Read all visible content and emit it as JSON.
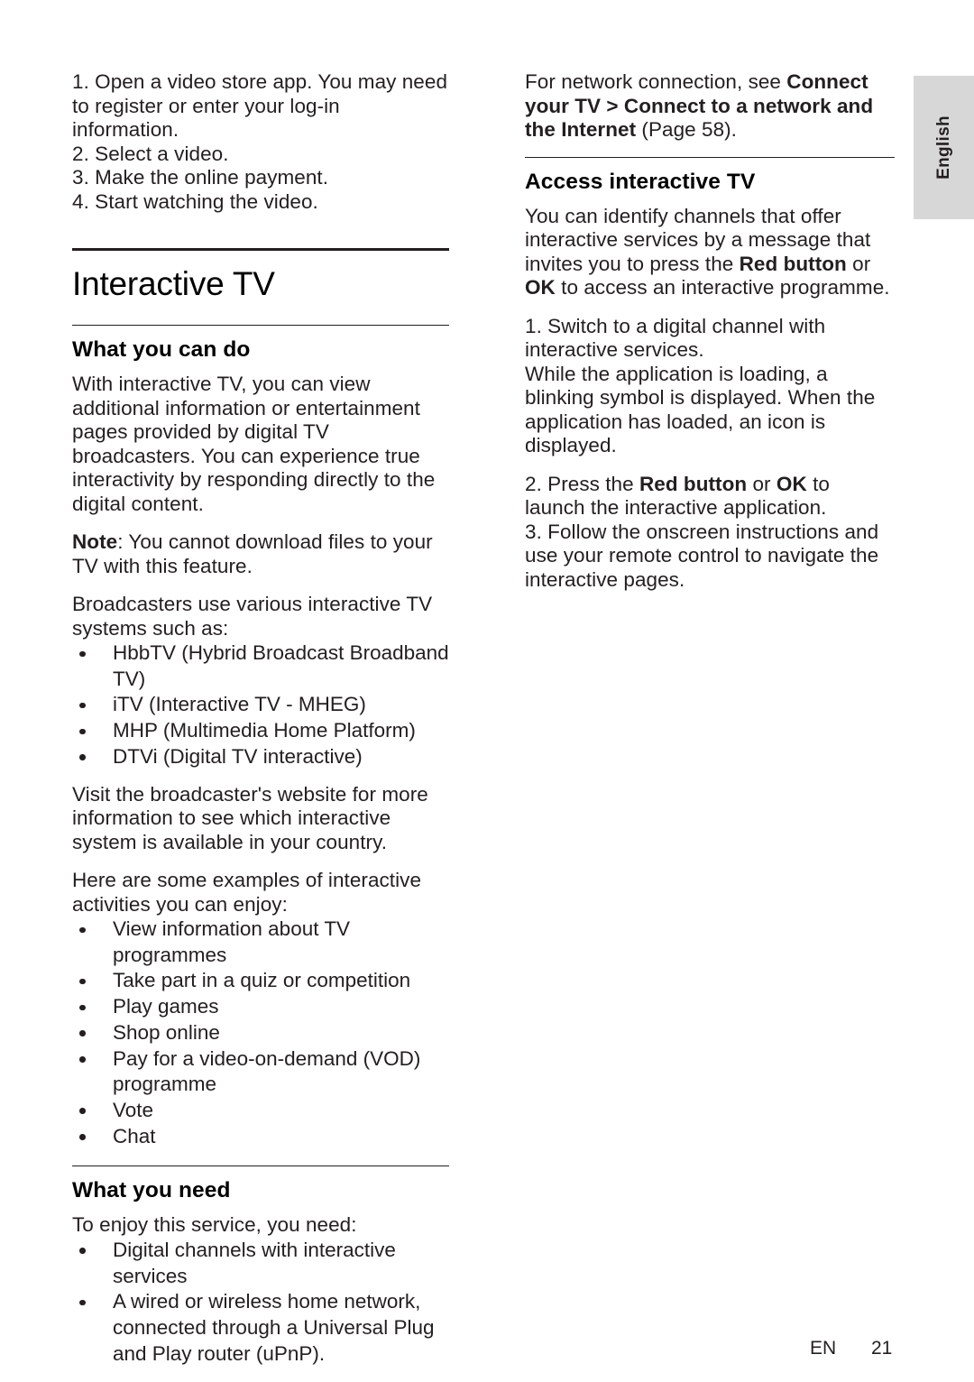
{
  "language_tab": {
    "label": "English"
  },
  "left_column": {
    "intro_steps": [
      "1. Open a video store app. You may need to register or enter your log-in information.",
      "2. Select a video.",
      "3. Make the online payment.",
      "4. Start watching the video."
    ],
    "chapter_title": "Interactive TV",
    "section_what_you_can_do": {
      "heading": "What you can do",
      "para1": "With interactive TV, you can view additional information or entertainment pages provided by digital TV broadcasters. You can experience true interactivity by responding directly to the digital content.",
      "note_label": "Note",
      "note_text": ": You cannot download files to your TV with this feature.",
      "para2": "Broadcasters use various interactive TV systems such as:",
      "systems": [
        "HbbTV (Hybrid Broadcast Broadband TV)",
        "iTV (Interactive TV - MHEG)",
        "MHP (Multimedia Home Platform)",
        "DTVi (Digital TV interactive)"
      ],
      "para3": "Visit the broadcaster's website for more information to see which interactive system is available in your country.",
      "para4": "Here are some examples of interactive activities you can enjoy:",
      "activities": [
        "View information about TV programmes",
        "Take part in a quiz or competition",
        "Play games",
        "Shop online",
        "Pay for a video-on-demand (VOD) programme",
        "Vote",
        "Chat"
      ]
    },
    "section_what_you_need": {
      "heading": "What you need",
      "intro": "To enjoy this service, you need:",
      "requirements": [
        "Digital channels with interactive services",
        "A wired or wireless home network, connected through a Universal Plug and Play router (uPnP)."
      ]
    }
  },
  "right_column": {
    "network_note": {
      "prefix": "For network connection, see ",
      "bold_ref": "Connect your TV > Connect to a network and the Internet",
      "suffix": " (Page 58)."
    },
    "section_access": {
      "heading": "Access interactive TV",
      "para1_a": "You can identify channels that offer interactive services by a message that invites you to press the ",
      "para1_bold1": "Red button",
      "para1_b": " or ",
      "para1_bold2": "OK",
      "para1_c": " to access an interactive programme.",
      "step1": "1. Switch to a digital channel with interactive services.",
      "step1_note": "While the application is loading, a blinking symbol is displayed. When the application has loaded, an icon is displayed.",
      "step2_a": "2. Press the ",
      "step2_bold1": "Red button",
      "step2_b": " or ",
      "step2_bold2": "OK",
      "step2_c": " to launch the interactive application.",
      "step3": "3. Follow the onscreen instructions and use your remote control to navigate the interactive pages."
    }
  },
  "footer": {
    "language_code": "EN",
    "page_number": "21"
  }
}
